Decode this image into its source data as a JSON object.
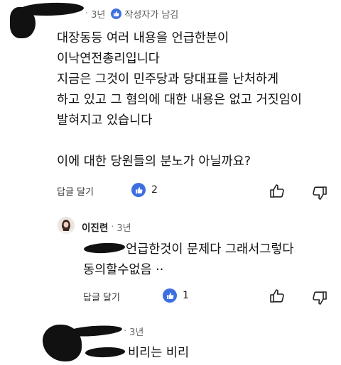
{
  "comment": {
    "age": "3년",
    "author_liked_label": "작성자가 남김",
    "lines": [
      "대장동등 여러 내용을 언급한분이",
      "이낙연전총리입니다",
      "지금은 그것이 민주당과 당대표를 난처하게",
      "하고 있고 그 혐의에 대한 내용은 없고 거짓임이",
      "발혀지고 있습니다",
      "",
      "이에 대한 당원들의 분노가 아닐까요?"
    ],
    "reply_label": "답글 달기",
    "like_count": "2"
  },
  "reply1": {
    "name": "이진련",
    "age": "3년",
    "lines": [
      "언급한것이 문제다 그래서그렇다",
      "동의할수없음 ··"
    ],
    "reply_label": "답글 달기",
    "like_count": "1"
  },
  "reply2": {
    "age": "3년",
    "text": "비리는 비리"
  },
  "icons": {
    "like": "thumbs-up-icon",
    "dislike": "thumbs-down-icon",
    "liked_badge": "blue-thumbs-up-badge"
  },
  "colors": {
    "accent": "#3d6fe0",
    "redaction": "#111111"
  }
}
